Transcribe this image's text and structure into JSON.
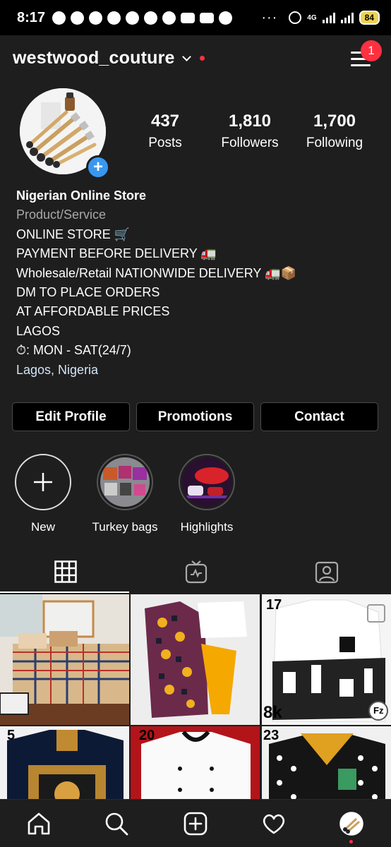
{
  "status_bar": {
    "time": "8:17",
    "network": "4G",
    "battery": "84"
  },
  "header": {
    "username": "westwood_couture",
    "menu_badge": "1"
  },
  "profile": {
    "stats": [
      {
        "value": "437",
        "label": "Posts"
      },
      {
        "value": "1,810",
        "label": "Followers"
      },
      {
        "value": "1,700",
        "label": "Following"
      }
    ],
    "name": "Nigerian Online Store",
    "category": "Product/Service",
    "bio_lines": [
      "ONLINE STORE 🛒",
      "PAYMENT BEFORE DELIVERY 🚛",
      "Wholesale/Retail NATIONWIDE DELIVERY 🚛📦",
      "DM TO PLACE ORDERS",
      "AT AFFORDABLE PRICES",
      "LAGOS",
      "⏱: MON - SAT(24/7)"
    ],
    "location": "Lagos, Nigeria"
  },
  "buttons": {
    "edit_profile": "Edit Profile",
    "promotions": "Promotions",
    "contact": "Contact"
  },
  "highlights": [
    {
      "label": "New"
    },
    {
      "label": "Turkey bags"
    },
    {
      "label": "Highlights"
    }
  ],
  "grid": {
    "posts": [
      {
        "number": ""
      },
      {
        "number": ""
      },
      {
        "number": "17",
        "bottom_text": "8k",
        "corner_logo": "Fz"
      },
      {
        "number": "5"
      },
      {
        "number": "20"
      },
      {
        "number": "23"
      }
    ]
  },
  "colors": {
    "accent": "#3897f0",
    "badge": "#ff3040",
    "background": "#1e1e1e"
  }
}
